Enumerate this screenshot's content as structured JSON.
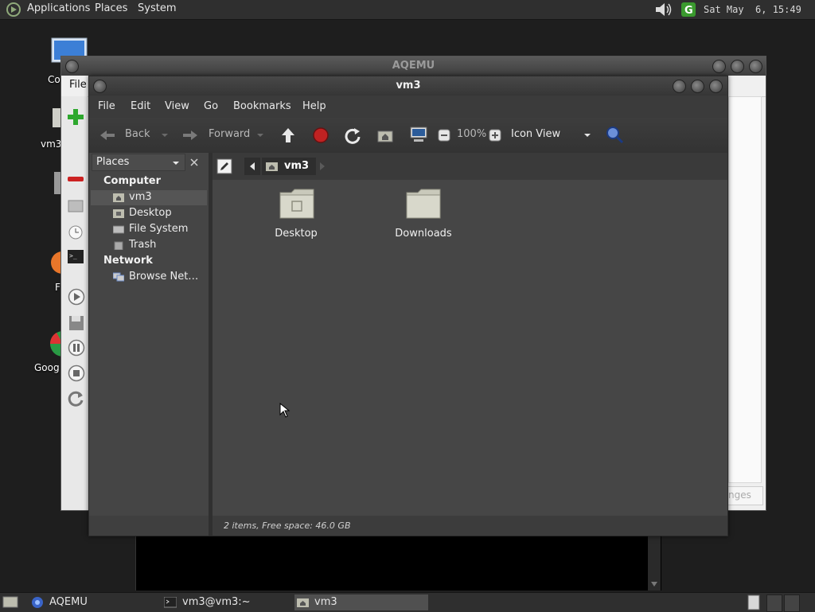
{
  "top_panel": {
    "menus": [
      "Applications",
      "Places",
      "System"
    ],
    "clock": "Sat May  6, 15:49"
  },
  "desktop": {
    "icons": [
      "Co",
      "vm3",
      "F",
      "Goog"
    ]
  },
  "aqemu_window": {
    "title": "AQEMU",
    "menu_file": "File",
    "apply_button": "nges"
  },
  "nautilus": {
    "title": "vm3",
    "menubar": [
      "File",
      "Edit",
      "View",
      "Go",
      "Bookmarks",
      "Help"
    ],
    "toolbar": {
      "back": "Back",
      "forward": "Forward",
      "zoom": "100%",
      "view_mode": "Icon View"
    },
    "sidebar": {
      "selector": "Places",
      "computer_header": "Computer",
      "computer_items": [
        "vm3",
        "Desktop",
        "File System",
        "Trash"
      ],
      "network_header": "Network",
      "network_items": [
        "Browse Net…"
      ]
    },
    "pathbar": {
      "current": "vm3"
    },
    "items": [
      "Desktop",
      "Downloads"
    ],
    "status": "2 items, Free space: 46.0 GB"
  },
  "bottom_panel": {
    "tasks": [
      "AQEMU",
      "vm3@vm3:~",
      "vm3"
    ]
  },
  "colors": {
    "panel": "#2f2f2f",
    "window_dark": "#3f3f3f",
    "content": "#464646",
    "accent_green": "#2ea82e",
    "accent_red": "#cc2222"
  }
}
